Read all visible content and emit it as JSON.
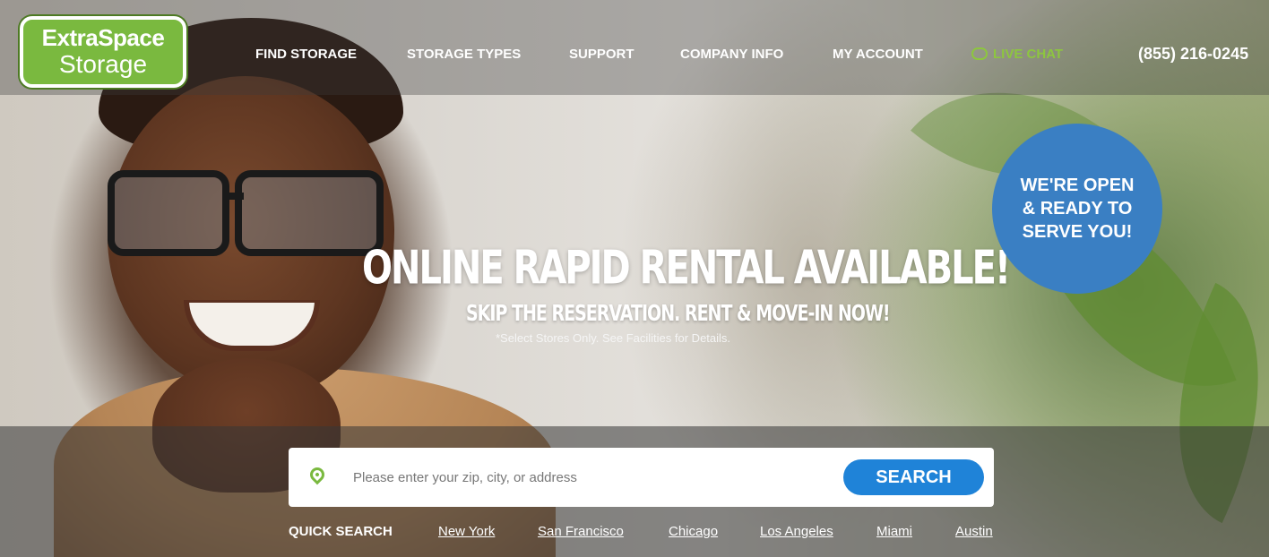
{
  "logo": {
    "line1": "ExtraSpace",
    "line2": "Storage"
  },
  "nav": {
    "items": [
      {
        "label": "FIND STORAGE"
      },
      {
        "label": "STORAGE TYPES"
      },
      {
        "label": "SUPPORT"
      },
      {
        "label": "COMPANY INFO"
      },
      {
        "label": "MY ACCOUNT"
      }
    ],
    "live_chat": "LIVE CHAT",
    "phone": "(855) 216-0245"
  },
  "hero": {
    "headline": "ONLINE RAPID RENTAL AVAILABLE!",
    "subhead": "SKIP THE RESERVATION. RENT & MOVE-IN NOW!",
    "disclaimer": "*Select Stores Only. See Facilities for Details.",
    "badge": {
      "line1": "WE'RE OPEN",
      "line2": "& READY TO",
      "line3": "SERVE YOU!"
    }
  },
  "search": {
    "placeholder": "Please enter your zip, city, or address",
    "button_label": "SEARCH"
  },
  "quick_search": {
    "label": "QUICK SEARCH",
    "cities": [
      "New York",
      "San Francisco",
      "Chicago",
      "Los Angeles",
      "Miami",
      "Austin"
    ]
  },
  "colors": {
    "brand_green": "#7ab93f",
    "live_chat_green": "#8dc63f",
    "search_blue": "#1f83d8",
    "badge_blue": "#3a7fc3"
  },
  "icons": {
    "location": "map-pin-icon",
    "chat": "chat-bubble-icon"
  }
}
